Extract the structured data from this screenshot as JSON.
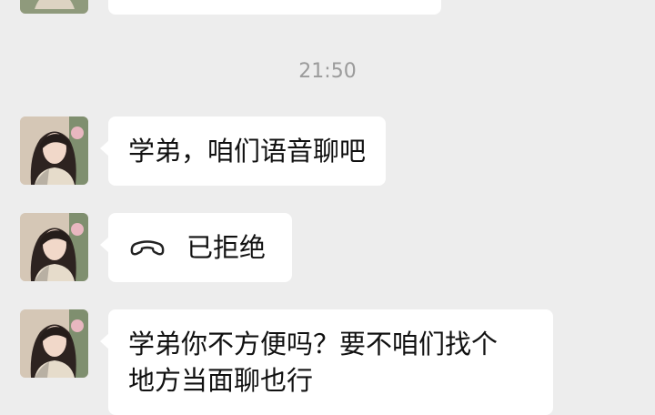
{
  "chat": {
    "timestamp": "21:50",
    "messages": [
      {
        "type": "text",
        "text": ""
      },
      {
        "type": "text",
        "text": "学弟，咱们语音聊吧"
      },
      {
        "type": "call",
        "icon": "phone-hangup-icon",
        "text": "已拒绝"
      },
      {
        "type": "text",
        "lines": [
          "学弟你不方便吗？要不咱们找个",
          "地方当面聊也行"
        ]
      }
    ]
  },
  "colors": {
    "background": "#ededed",
    "bubble": "#ffffff",
    "text": "#111111",
    "timestamp": "#9b9b9b"
  }
}
